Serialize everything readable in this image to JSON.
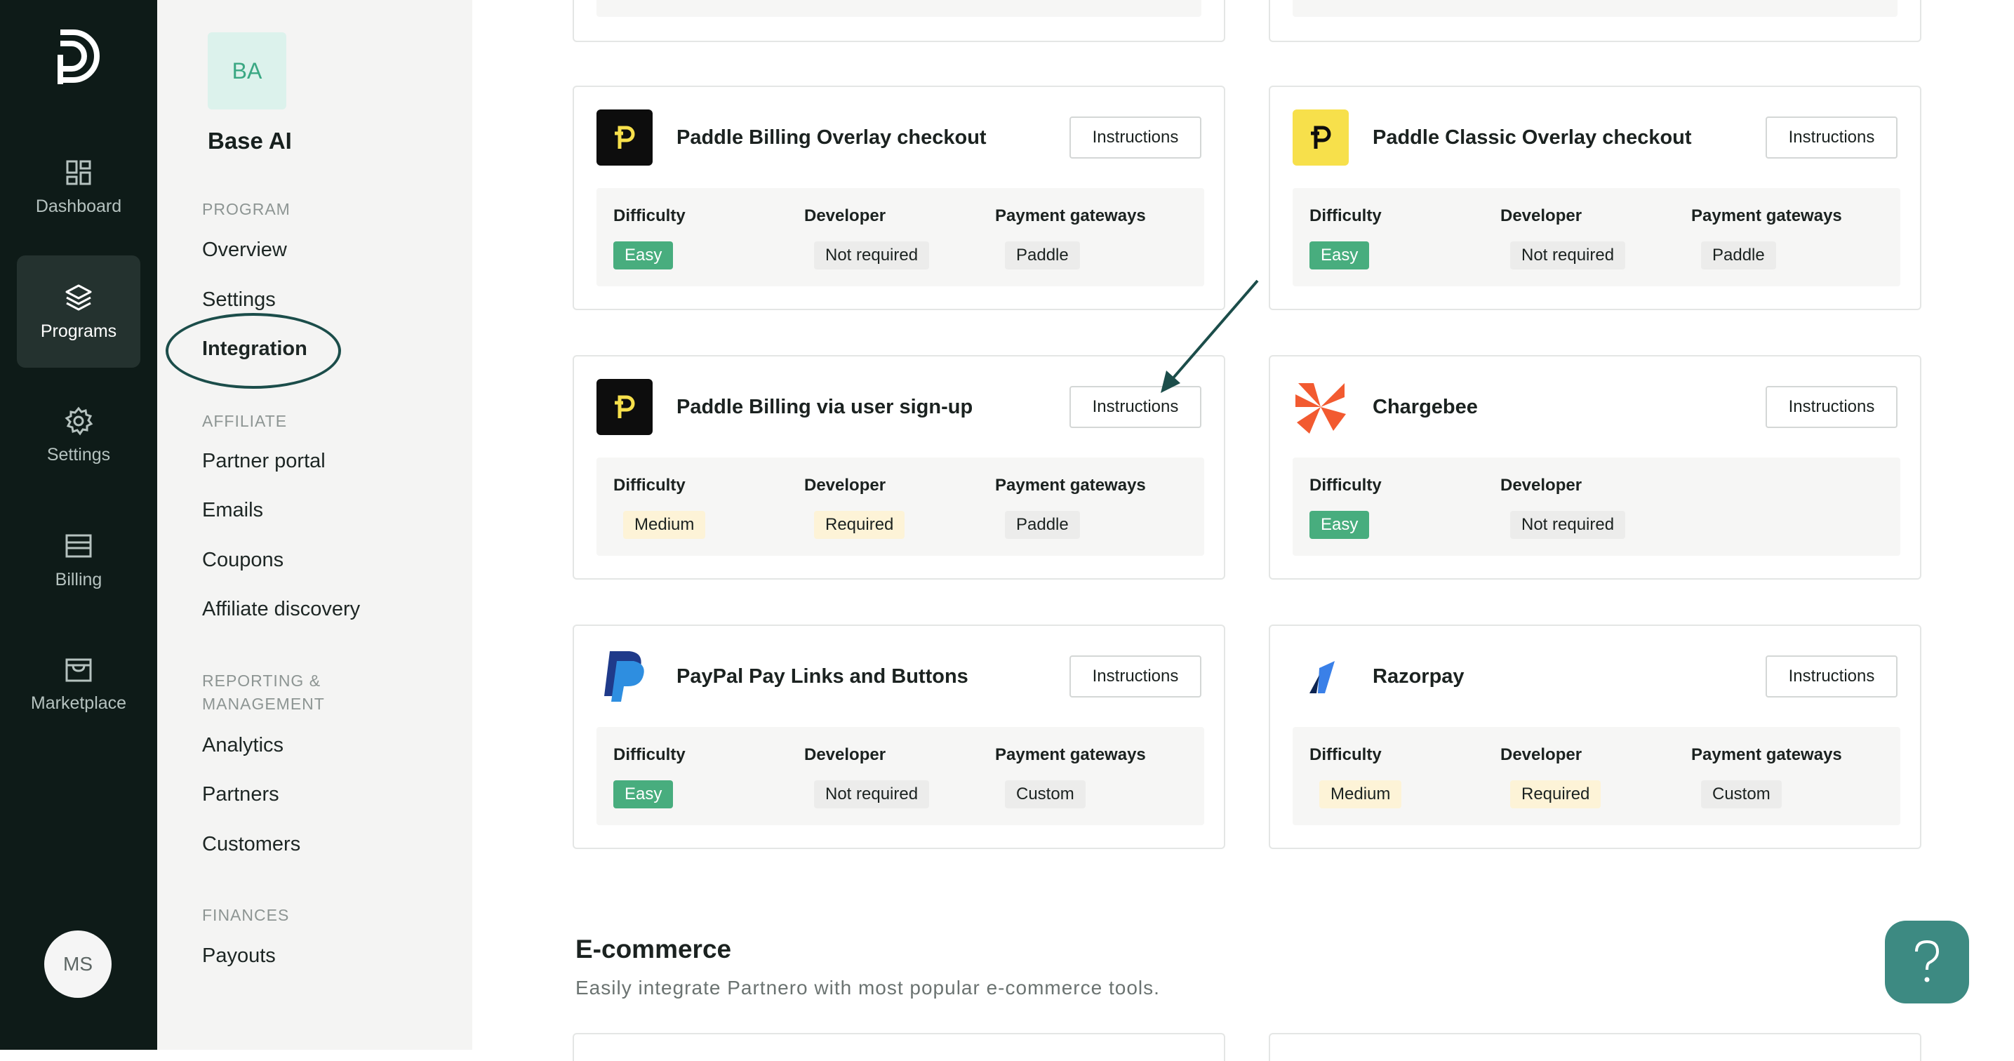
{
  "rail": {
    "items": [
      {
        "label": "Dashboard",
        "icon": "dashboard-icon"
      },
      {
        "label": "Programs",
        "icon": "layers-icon"
      },
      {
        "label": "Settings",
        "icon": "gear-icon"
      },
      {
        "label": "Billing",
        "icon": "billing-icon"
      },
      {
        "label": "Marketplace",
        "icon": "store-icon"
      }
    ],
    "user_initials": "MS"
  },
  "sidebar": {
    "program_initials": "BA",
    "program_name": "Base AI",
    "sections": {
      "program": "PROGRAM",
      "affiliate": "AFFILIATE",
      "reporting_line1": "REPORTING &",
      "reporting_line2": "MANAGEMENT",
      "finances": "FINANCES"
    },
    "links": {
      "overview": "Overview",
      "settings": "Settings",
      "integration": "Integration",
      "partner_portal": "Partner portal",
      "emails": "Emails",
      "coupons": "Coupons",
      "affiliate_discovery": "Affiliate discovery",
      "analytics": "Analytics",
      "partners": "Partners",
      "customers": "Customers",
      "payouts": "Payouts"
    }
  },
  "labels": {
    "instructions": "Instructions",
    "difficulty": "Difficulty",
    "developer": "Developer",
    "payment_gateways": "Payment gateways"
  },
  "integrations": [
    {
      "title": "Paddle Billing Overlay checkout",
      "difficulty": "Easy",
      "developer": "Not required",
      "gateway": "Paddle"
    },
    {
      "title": "Paddle Classic Overlay checkout",
      "difficulty": "Easy",
      "developer": "Not required",
      "gateway": "Paddle"
    },
    {
      "title": "Paddle Billing via user sign-up",
      "difficulty": "Medium",
      "developer": "Required",
      "gateway": "Paddle"
    },
    {
      "title": "Chargebee",
      "difficulty": "Easy",
      "developer": "Not required",
      "gateway": ""
    },
    {
      "title": "PayPal Pay Links and Buttons",
      "difficulty": "Easy",
      "developer": "Not required",
      "gateway": "Custom"
    },
    {
      "title": "Razorpay",
      "difficulty": "Medium",
      "developer": "Required",
      "gateway": "Custom"
    }
  ],
  "ecommerce": {
    "heading": "E-commerce",
    "subtitle": "Easily integrate Partnero with most popular e-commerce tools."
  },
  "colors": {
    "rail_bg": "#0e1b18",
    "sidebar_bg": "#f4f4f3",
    "easy": "#48ad7e",
    "medium": "#fdf3d7",
    "accent": "#3d8a82"
  }
}
